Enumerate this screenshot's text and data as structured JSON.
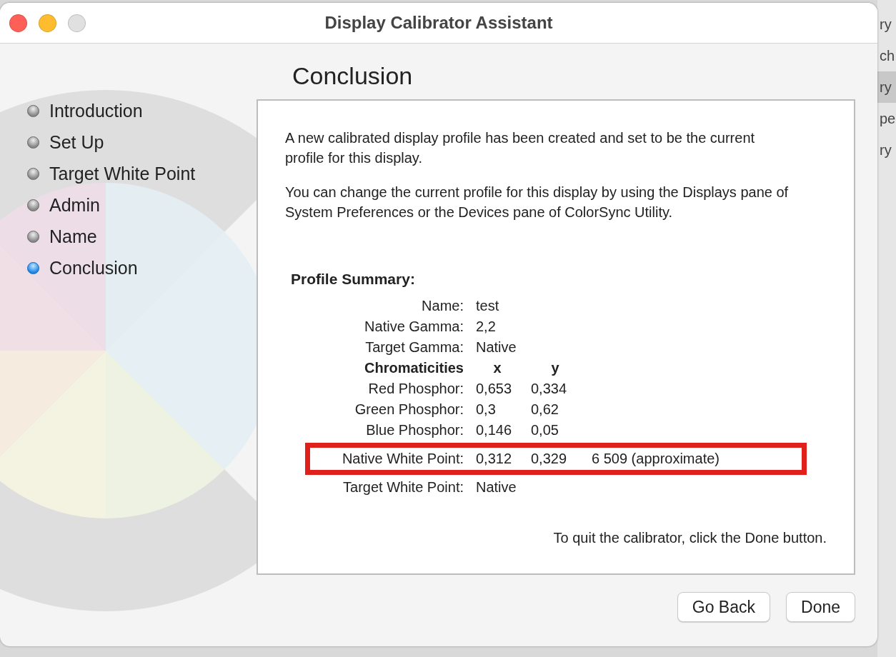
{
  "window": {
    "title": "Display Calibrator Assistant",
    "controls": [
      {
        "kind": "close",
        "disabled": false
      },
      {
        "kind": "minimize",
        "disabled": false
      },
      {
        "kind": "zoom",
        "disabled": true
      }
    ]
  },
  "steps": [
    {
      "label": "Introduction",
      "selected": false
    },
    {
      "label": "Set Up",
      "selected": false
    },
    {
      "label": "Target White Point",
      "selected": false
    },
    {
      "label": "Admin",
      "selected": false
    },
    {
      "label": "Name",
      "selected": false
    },
    {
      "label": "Conclusion",
      "selected": true
    }
  ],
  "heading": "Conclusion",
  "panel": {
    "paragraphs": [
      "A new calibrated display profile has been created and set to be the current profile for this display.",
      "You can change the current profile for this display by using the Displays pane of System Preferences or the Devices pane of ColorSync Utility."
    ],
    "summary_title": "Profile Summary:",
    "rows": [
      {
        "kind": "field",
        "label": "Name:",
        "values": [
          "test"
        ],
        "highlighted": false
      },
      {
        "kind": "field",
        "label": "Native Gamma:",
        "values": [
          "2,2"
        ],
        "highlighted": false
      },
      {
        "kind": "field",
        "label": "Target Gamma:",
        "values": [
          "Native"
        ],
        "highlighted": false
      },
      {
        "kind": "header",
        "label": "Chromaticities",
        "values": [
          "x",
          "y"
        ],
        "highlighted": false
      },
      {
        "kind": "field",
        "label": "Red Phosphor:",
        "values": [
          "0,653",
          "0,334"
        ],
        "highlighted": false
      },
      {
        "kind": "field",
        "label": "Green Phosphor:",
        "values": [
          "0,3",
          "0,62"
        ],
        "highlighted": false
      },
      {
        "kind": "field",
        "label": "Blue Phosphor:",
        "values": [
          "0,146",
          "0,05"
        ],
        "highlighted": false
      },
      {
        "kind": "field",
        "label": "Native White Point:",
        "values": [
          "0,312",
          "0,329",
          "6 509 (approximate)"
        ],
        "highlighted": true
      },
      {
        "kind": "field",
        "label": "Target White Point:",
        "values": [
          "Native"
        ],
        "highlighted": false
      }
    ],
    "footer_note": "To quit the calibrator, click the Done button."
  },
  "buttons": [
    "Go Back",
    "Done"
  ],
  "background_window": {
    "items": [
      {
        "label": "ry",
        "selected": false
      },
      {
        "label": "ch",
        "selected": false
      },
      {
        "label": "ry",
        "selected": true
      },
      {
        "label": "pe",
        "selected": false
      },
      {
        "label": "ry",
        "selected": false
      }
    ]
  }
}
